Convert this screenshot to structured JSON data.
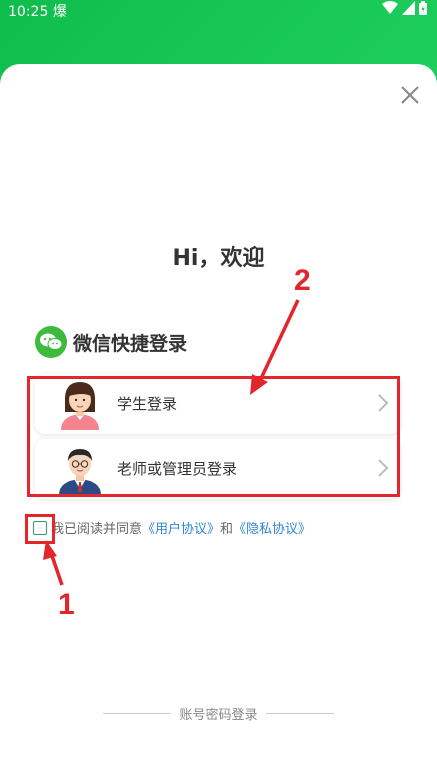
{
  "status_bar": {
    "time": "10:25",
    "extra_glyph": "爆"
  },
  "welcome": {
    "title": "Hi，欢迎"
  },
  "wechat_login": {
    "label": "微信快捷登录",
    "accent": "#3dbb3d"
  },
  "options": {
    "student_label": "学生登录",
    "teacher_label": "老师或管理员登录"
  },
  "agreement": {
    "prefix": "我已阅读并同意",
    "user_agreement": "《用户协议》",
    "conjunction": "和",
    "privacy_agreement": "《隐私协议》"
  },
  "alt_login": {
    "label": "账号密码登录"
  },
  "annotations": {
    "marker_1": "1",
    "marker_2": "2",
    "color": "#e3262b"
  },
  "colors": {
    "header_green": "#13c866",
    "link_blue": "#2e86d6",
    "checkbox_green": "#2e9e6d"
  }
}
